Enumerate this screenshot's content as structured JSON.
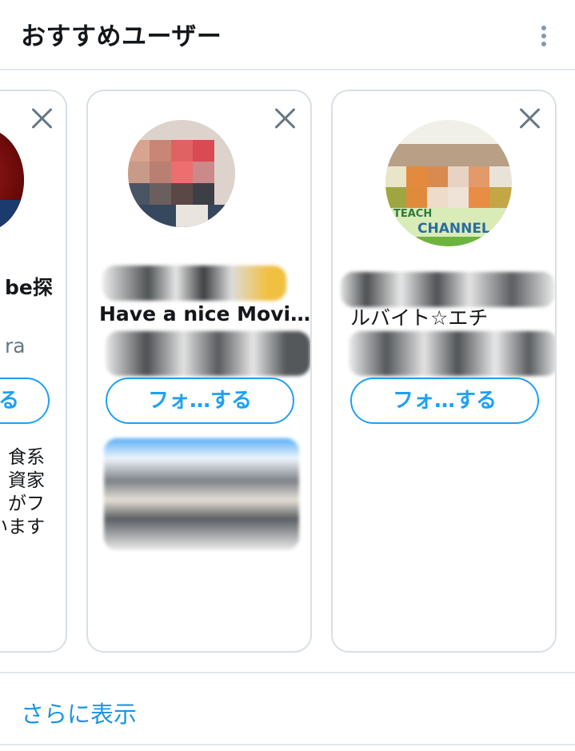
{
  "header": {
    "title": "おすすめユーザー",
    "more_icon": "more-vertical-icon"
  },
  "cards": [
    {
      "name_fragment": "be探",
      "handle_fragment": "ra",
      "follow_label": "る",
      "description_lines": [
        "食系",
        "資家",
        "がフ",
        "います"
      ]
    },
    {
      "name_line2": "Have a nice Movi…",
      "follow_label": "フォ…する"
    },
    {
      "name_line2": "ルバイト☆エチ",
      "avatar_texts": [
        "TEACH",
        "CHANNEL"
      ],
      "follow_label": "フォ…する"
    }
  ],
  "footer": {
    "show_more_label": "さらに表示"
  },
  "colors": {
    "accent": "#1da1f2",
    "link": "#1b95e0",
    "text_primary": "#14171a",
    "text_secondary": "#657786",
    "border": "#e1e8ed"
  }
}
